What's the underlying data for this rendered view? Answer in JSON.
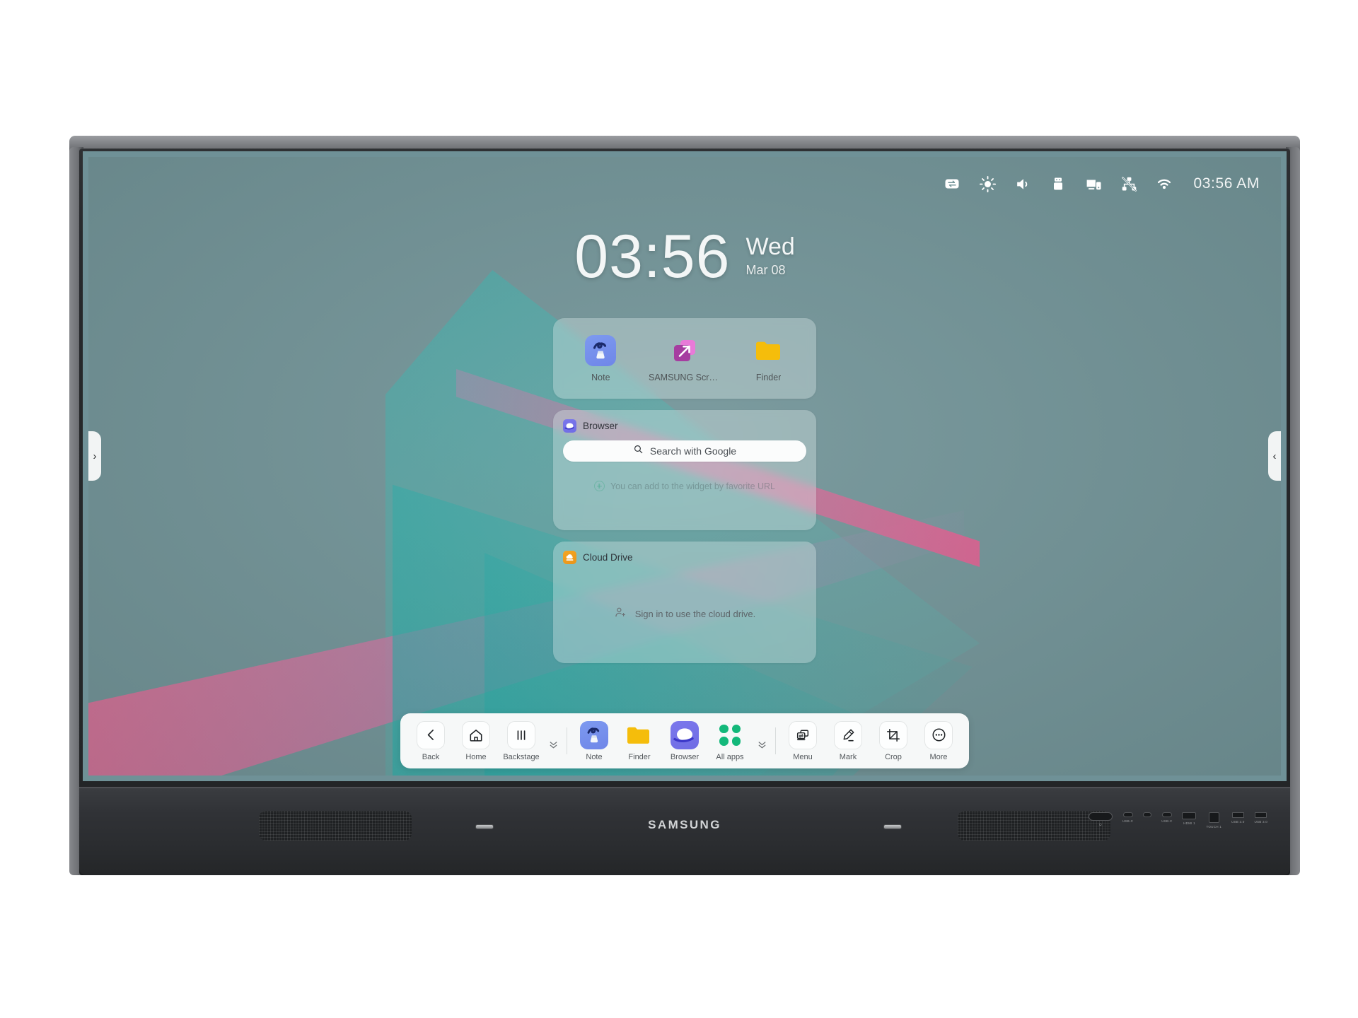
{
  "device": {
    "brand": "SAMSUNG",
    "handle_left_glyph": "›",
    "handle_right_glyph": "‹",
    "ports": [
      {
        "name": "power-button",
        "label": "⏻",
        "glyph_class": "g-power"
      },
      {
        "name": "usb-c-port",
        "label": "USB-C",
        "glyph_class": "g-usbc"
      },
      {
        "name": "audio-jack",
        "label": "",
        "glyph_class": "g-jack"
      },
      {
        "name": "usb-c-port-2",
        "label": "USB-C",
        "glyph_class": "g-usbc2"
      },
      {
        "name": "hdmi-port",
        "label": "HDMI 1",
        "glyph_class": "g-hdmi"
      },
      {
        "name": "touch-port",
        "label": "TOUCH 1",
        "glyph_class": "g-touch"
      },
      {
        "name": "usb-port-1",
        "label": "USB 3.0",
        "glyph_class": "g-usb"
      },
      {
        "name": "usb-port-2",
        "label": "USB 3.0",
        "glyph_class": "g-usb"
      }
    ]
  },
  "statusbar": {
    "icons": [
      {
        "name": "input-source-icon",
        "title": "Source"
      },
      {
        "name": "brightness-icon",
        "title": "Brightness"
      },
      {
        "name": "volume-icon",
        "title": "Volume"
      },
      {
        "name": "usb-icon",
        "title": "USB"
      },
      {
        "name": "screen-share-icon",
        "title": "Screen share"
      },
      {
        "name": "network-disconnected-icon",
        "title": "Network disconnected"
      },
      {
        "name": "wifi-icon",
        "title": "Wi-Fi"
      }
    ],
    "time": "03:56 AM"
  },
  "clock": {
    "time": "03:56",
    "weekday": "Wed",
    "date": "Mar 08"
  },
  "shortcuts_widget": {
    "items": [
      {
        "label": "Note",
        "icon": "note-icon"
      },
      {
        "label": "SAMSUNG Screen…",
        "icon": "samsung-screen-icon"
      },
      {
        "label": "Finder",
        "icon": "finder-folder-icon"
      }
    ]
  },
  "browser_widget": {
    "title": "Browser",
    "icon": "browser-icon",
    "search_placeholder": "Search with Google",
    "search_icon": "search-icon",
    "hint": "You can add to the widget by favorite URL",
    "hint_icon": "plus-circle-icon"
  },
  "cloud_widget": {
    "title": "Cloud Drive",
    "icon": "cloud-drive-icon",
    "message": "Sign in to use the cloud drive.",
    "message_icon": "add-person-icon"
  },
  "taskbar": {
    "nav": [
      {
        "label": "Back",
        "icon": "back-chevron-icon"
      },
      {
        "label": "Home",
        "icon": "home-icon"
      },
      {
        "label": "Backstage",
        "icon": "backstage-bars-icon"
      }
    ],
    "collapse_left_icon": "chevron-double-down-icon",
    "apps": [
      {
        "label": "Note",
        "icon": "note-icon"
      },
      {
        "label": "Finder",
        "icon": "finder-folder-icon"
      },
      {
        "label": "Browser",
        "icon": "browser-icon"
      },
      {
        "label": "All apps",
        "icon": "all-apps-grid-icon"
      }
    ],
    "collapse_right_icon": "chevron-double-down-icon",
    "tools": [
      {
        "label": "Menu",
        "icon": "menu-windows-icon"
      },
      {
        "label": "Mark",
        "icon": "mark-pen-icon"
      },
      {
        "label": "Crop",
        "icon": "crop-icon"
      },
      {
        "label": "More",
        "icon": "more-dots-icon"
      }
    ]
  },
  "colors": {
    "wallpaper_base": "#739599",
    "wallpaper_pink": "#e26e96",
    "wallpaper_teal": "#3eb4b0",
    "note_blue": "#7288ea",
    "screen_purple": "#a63da0",
    "finder_yellow": "#f5bd0b",
    "browser_indigo": "#6f6ce4",
    "cloud_orange": "#f09b1e",
    "allapps_green": "#13b87a",
    "taskbar_bg": "#f6f8f8"
  }
}
